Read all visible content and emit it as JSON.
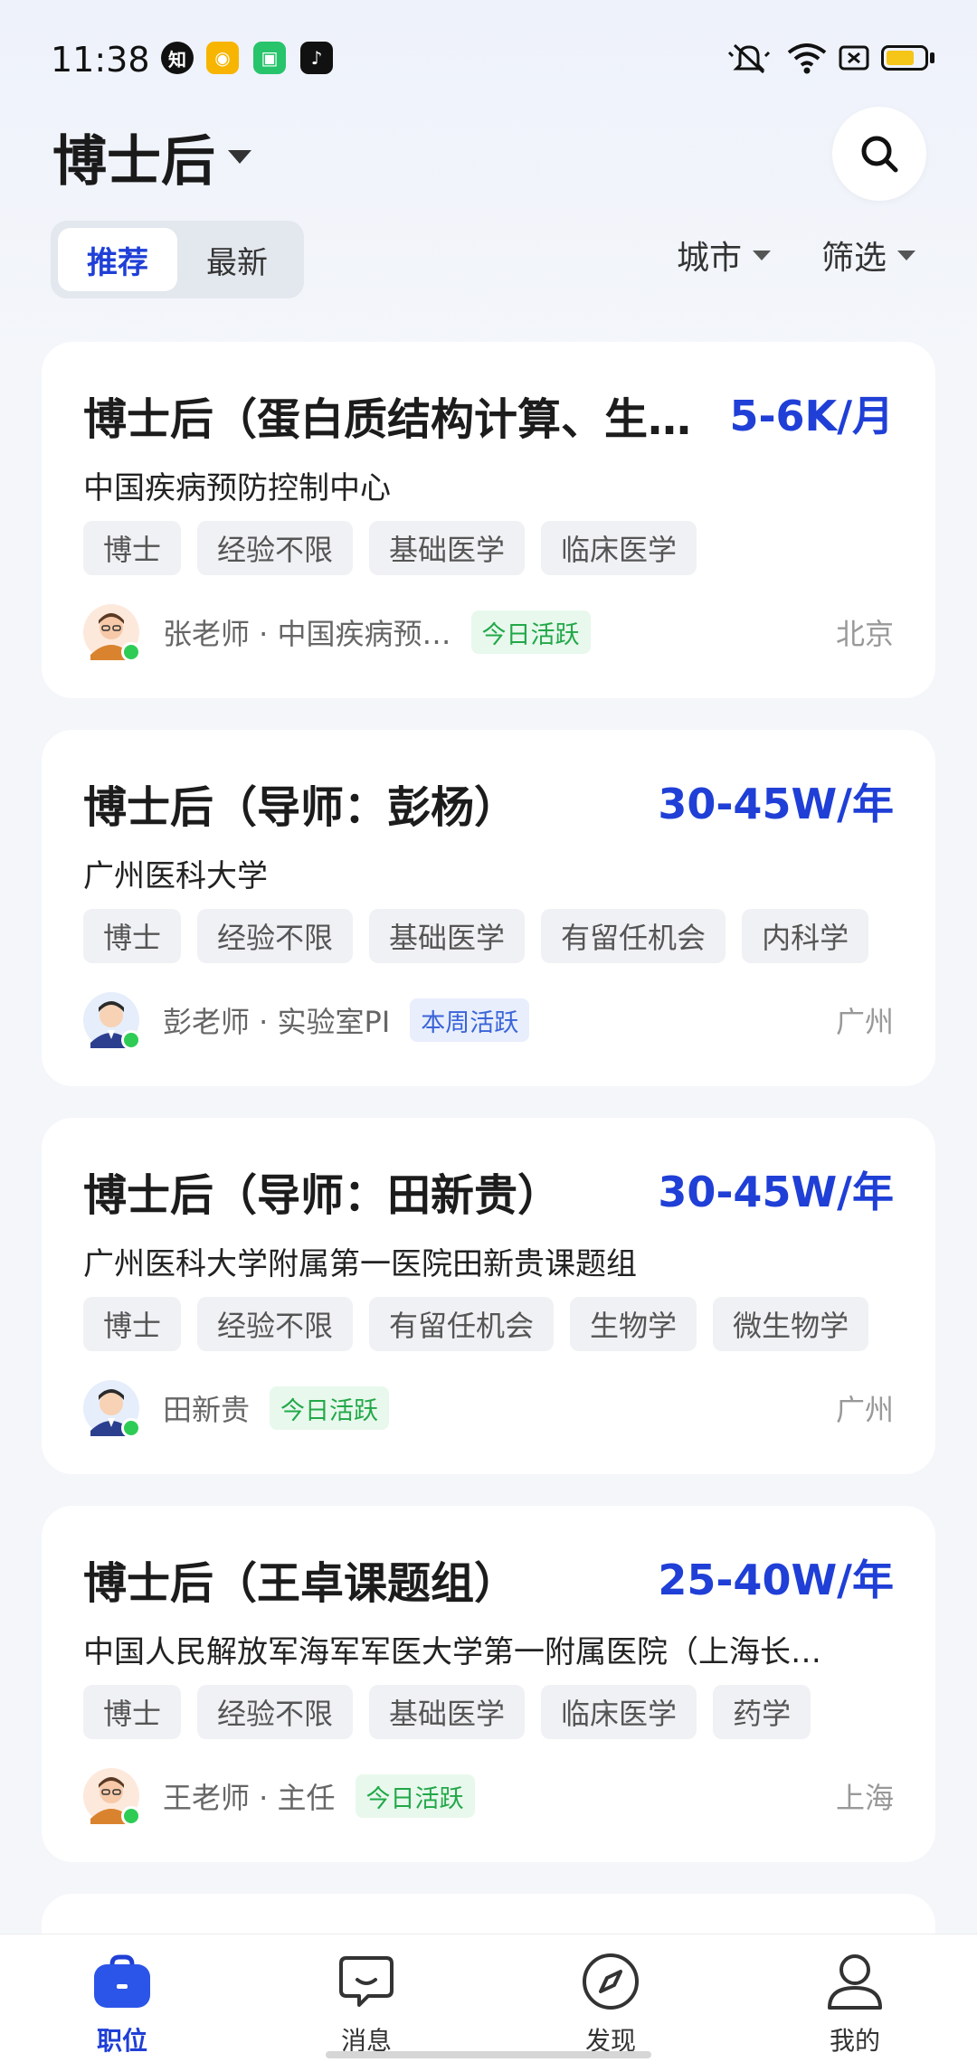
{
  "status_bar": {
    "time": "11:38",
    "apps": [
      {
        "icon": "zhihu-icon",
        "glyph": "知",
        "color": "#111111"
      },
      {
        "icon": "weibo-icon",
        "glyph": "◉",
        "color": "#f7b500"
      },
      {
        "icon": "shop-icon",
        "glyph": "▣",
        "color": "#27c46b"
      },
      {
        "icon": "tiktok-icon",
        "glyph": "♪",
        "color": "#111111"
      }
    ],
    "indicators": [
      "mute-icon",
      "wifi-icon",
      "sim-icon",
      "battery-icon"
    ]
  },
  "header": {
    "title": "博士后",
    "search_icon": "search-icon"
  },
  "tabs": [
    {
      "label": "推荐",
      "active": true
    },
    {
      "label": "最新",
      "active": false
    }
  ],
  "filters": {
    "city_label": "城市",
    "filter_label": "筛选"
  },
  "jobs": [
    {
      "title": "博士后（蛋白质结构计算、生…",
      "salary": "5-6K/月",
      "org": "中国疾病预防控制中心",
      "tags": [
        "博士",
        "经验不限",
        "基础医学",
        "临床医学"
      ],
      "poster": "张老师 · 中国疾病预…",
      "activity": "今日活跃",
      "activity_style": "green",
      "city": "北京"
    },
    {
      "title": "博士后（导师：彭杨）",
      "salary": "30-45W/年",
      "org": "广州医科大学",
      "tags": [
        "博士",
        "经验不限",
        "基础医学",
        "有留任机会",
        "内科学"
      ],
      "poster": "彭老师 · 实验室PI",
      "activity": "本周活跃",
      "activity_style": "blue",
      "city": "广州"
    },
    {
      "title": "博士后（导师：田新贵）",
      "salary": "30-45W/年",
      "org": "广州医科大学附属第一医院田新贵课题组",
      "tags": [
        "博士",
        "经验不限",
        "有留任机会",
        "生物学",
        "微生物学"
      ],
      "poster": "田新贵",
      "activity": "今日活跃",
      "activity_style": "green",
      "city": "广州"
    },
    {
      "title": "博士后（王卓课题组）",
      "salary": "25-40W/年",
      "org": "中国人民解放军海军军医大学第一附属医院（上海长…",
      "tags": [
        "博士",
        "经验不限",
        "基础医学",
        "临床医学",
        "药学"
      ],
      "poster": "王老师 · 主任",
      "activity": "今日活跃",
      "activity_style": "green",
      "city": "上海"
    }
  ],
  "bottom_nav": [
    {
      "label": "职位",
      "icon": "briefcase-icon",
      "active": true
    },
    {
      "label": "消息",
      "icon": "chat-icon",
      "active": false
    },
    {
      "label": "发现",
      "icon": "compass-icon",
      "active": false
    },
    {
      "label": "我的",
      "icon": "profile-icon",
      "active": false
    }
  ],
  "colors": {
    "accent": "#1f3fd6",
    "online": "#2ecc55",
    "badge_green_text": "#22a848",
    "badge_blue_text": "#3a64d8"
  }
}
